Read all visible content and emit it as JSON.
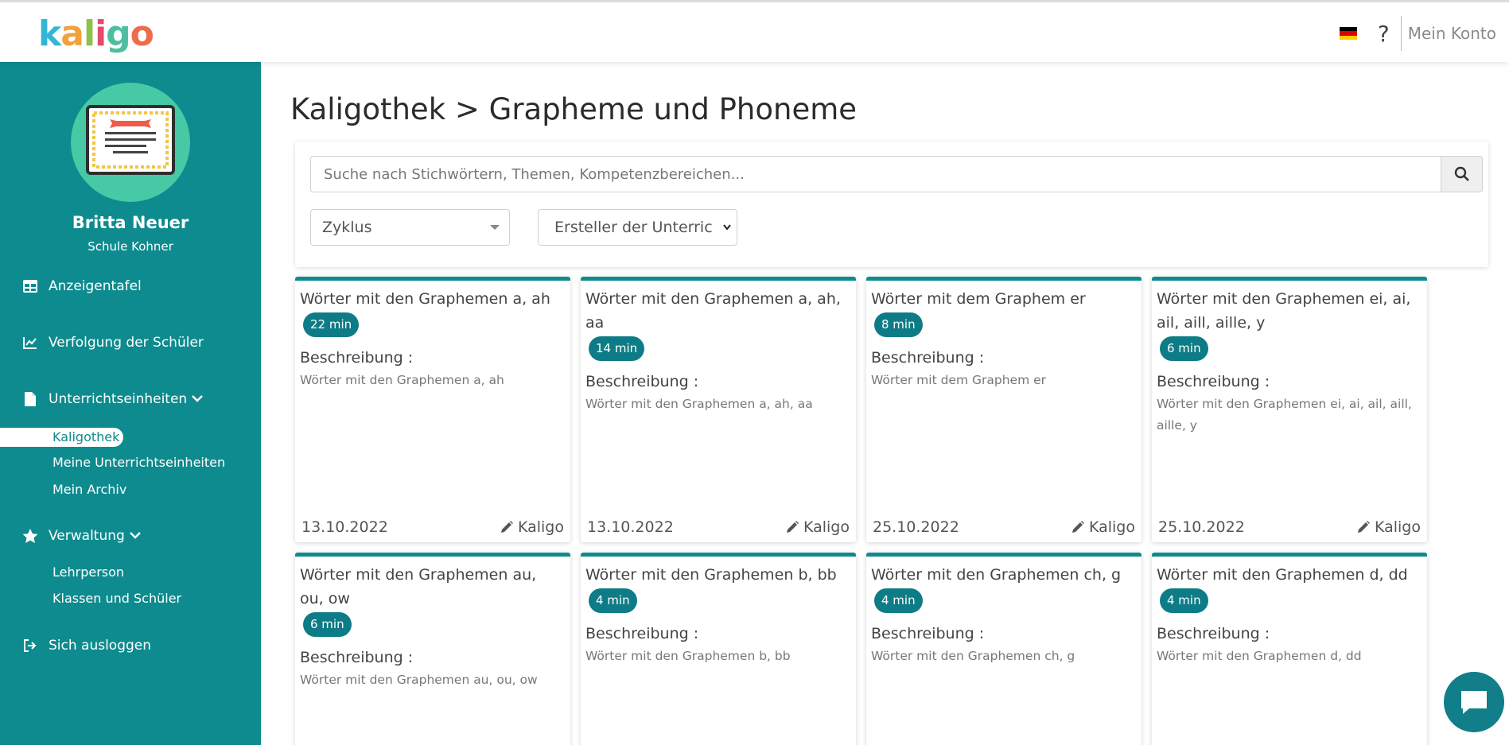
{
  "header": {
    "logo_letters": [
      "k",
      "a",
      "l",
      "i",
      "g",
      "o"
    ],
    "logo_colors": [
      "#35b5d6",
      "#f3a23a",
      "#8bc34a",
      "#e64a6a",
      "#4dbfa0",
      "#ef6b4a"
    ],
    "help_label": "?",
    "account_label": "Mein Konto",
    "language_flag": "german-flag-icon"
  },
  "sidebar": {
    "user_name": "Britta Neuer",
    "school": "Schule Kohner",
    "items": [
      {
        "label": "Anzeigentafel",
        "icon": "dashboard-icon"
      },
      {
        "label": "Verfolgung der Schüler",
        "icon": "chart-line-icon"
      },
      {
        "label": "Unterrichtseinheiten",
        "icon": "file-icon"
      },
      {
        "label": "Verwaltung",
        "icon": "star-icon"
      },
      {
        "label": "Sich ausloggen",
        "icon": "logout-icon"
      }
    ],
    "sub_units": [
      "Kaligothek",
      "Meine Unterrichtseinheiten",
      "Mein Archiv"
    ],
    "sub_admin": [
      "Lehrperson",
      "Klassen und Schüler"
    ],
    "accent": "#0e8b8f"
  },
  "main": {
    "title": "Kaligothek > Grapheme und Phoneme",
    "search_placeholder": "Suche nach Stichwörtern, Themen, Kompetenzbereichen...",
    "filter_cycle": "Zyklus",
    "filter_creator": "Ersteller der Unterric"
  },
  "cards": [
    {
      "title": "Wörter mit den Graphemen a, ah",
      "duration": "22 min",
      "desc_label": "Beschreibung :",
      "desc": "Wörter mit den Graphemen a, ah",
      "date": "13.10.2022",
      "author": "Kaligo"
    },
    {
      "title": "Wörter mit den Graphemen a, ah, aa",
      "duration": "14 min",
      "desc_label": "Beschreibung :",
      "desc": "Wörter mit den Graphemen a, ah, aa",
      "date": "13.10.2022",
      "author": "Kaligo"
    },
    {
      "title": "Wörter mit dem Graphem er",
      "duration": "8 min",
      "desc_label": "Beschreibung :",
      "desc": "Wörter mit dem Graphem er",
      "date": "25.10.2022",
      "author": "Kaligo"
    },
    {
      "title": "Wörter mit den Graphemen ei, ai, ail, aill, aille, y",
      "duration": "6 min",
      "desc_label": "Beschreibung :",
      "desc": "Wörter mit den Graphemen ei, ai, ail, aill, aille, y",
      "date": "25.10.2022",
      "author": "Kaligo"
    },
    {
      "title": "Wörter mit den Graphemen au, ou, ow",
      "duration": "6 min",
      "desc_label": "Beschreibung :",
      "desc": "Wörter mit den Graphemen au, ou, ow",
      "date": "",
      "author": ""
    },
    {
      "title": "Wörter mit den Graphemen b, bb",
      "duration": "4 min",
      "desc_label": "Beschreibung :",
      "desc": "Wörter mit den Graphemen b, bb",
      "date": "",
      "author": ""
    },
    {
      "title": "Wörter mit den Graphemen ch, g",
      "duration": "4 min",
      "desc_label": "Beschreibung :",
      "desc": "Wörter mit den Graphemen ch, g",
      "date": "",
      "author": ""
    },
    {
      "title": "Wörter mit den Graphemen d, dd",
      "duration": "4 min",
      "desc_label": "Beschreibung :",
      "desc": "Wörter mit den Graphemen d, dd",
      "date": "",
      "author": ""
    }
  ],
  "chat": {
    "icon": "chat-icon"
  }
}
